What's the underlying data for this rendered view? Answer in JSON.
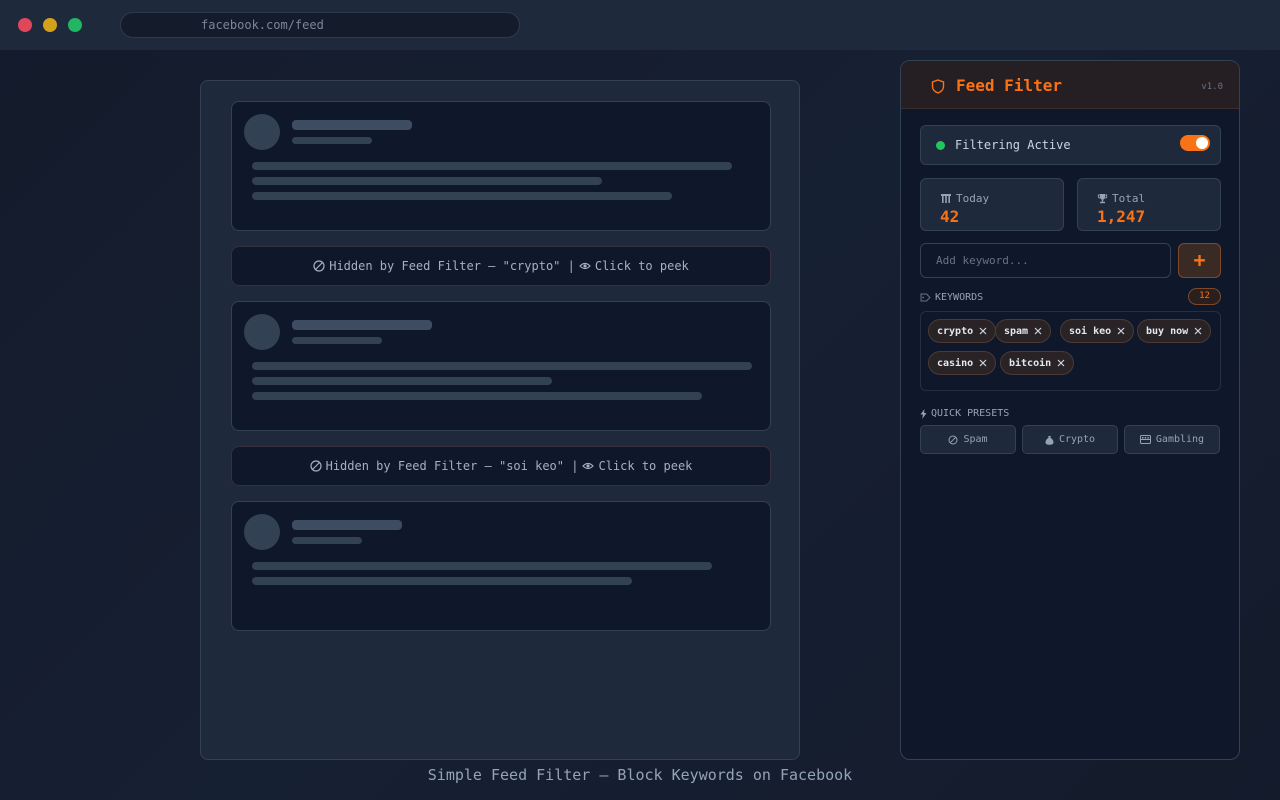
{
  "browser": {
    "url": "facebook.com/feed"
  },
  "feed": {
    "hidden_posts": [
      {
        "prefix": "Hidden by Feed Filter — \"crypto\" | ",
        "action": "Click to peek"
      },
      {
        "prefix": "Hidden by Feed Filter — \"soi keo\" | ",
        "action": "Click to peek"
      }
    ]
  },
  "extension": {
    "title": "Feed Filter",
    "version": "v1.0",
    "status_label": "Filtering Active",
    "filtering_enabled": true,
    "stats": {
      "today_label": "Today",
      "today_value": "42",
      "total_label": "Total",
      "total_value": "1,247"
    },
    "keyword_input": {
      "placeholder": "Add keyword...",
      "value": ""
    },
    "add_button_label": "+",
    "keywords_label": "KEYWORDS",
    "keywords_count": "12",
    "keywords": [
      "crypto",
      "spam",
      "soi keo",
      "buy now",
      "casino",
      "bitcoin"
    ],
    "presets_label": "QUICK PRESETS",
    "presets": [
      {
        "icon": "ban-icon",
        "label": "Spam"
      },
      {
        "icon": "money-bag-icon",
        "label": "Crypto"
      },
      {
        "icon": "slot-machine-icon",
        "label": "Gambling"
      }
    ]
  },
  "caption": "Simple Feed Filter — Block Keywords on Facebook",
  "colors": {
    "accent": "#f97316",
    "status_active": "#22c55e",
    "background": "#141b2b",
    "panel": "#0f172a"
  }
}
